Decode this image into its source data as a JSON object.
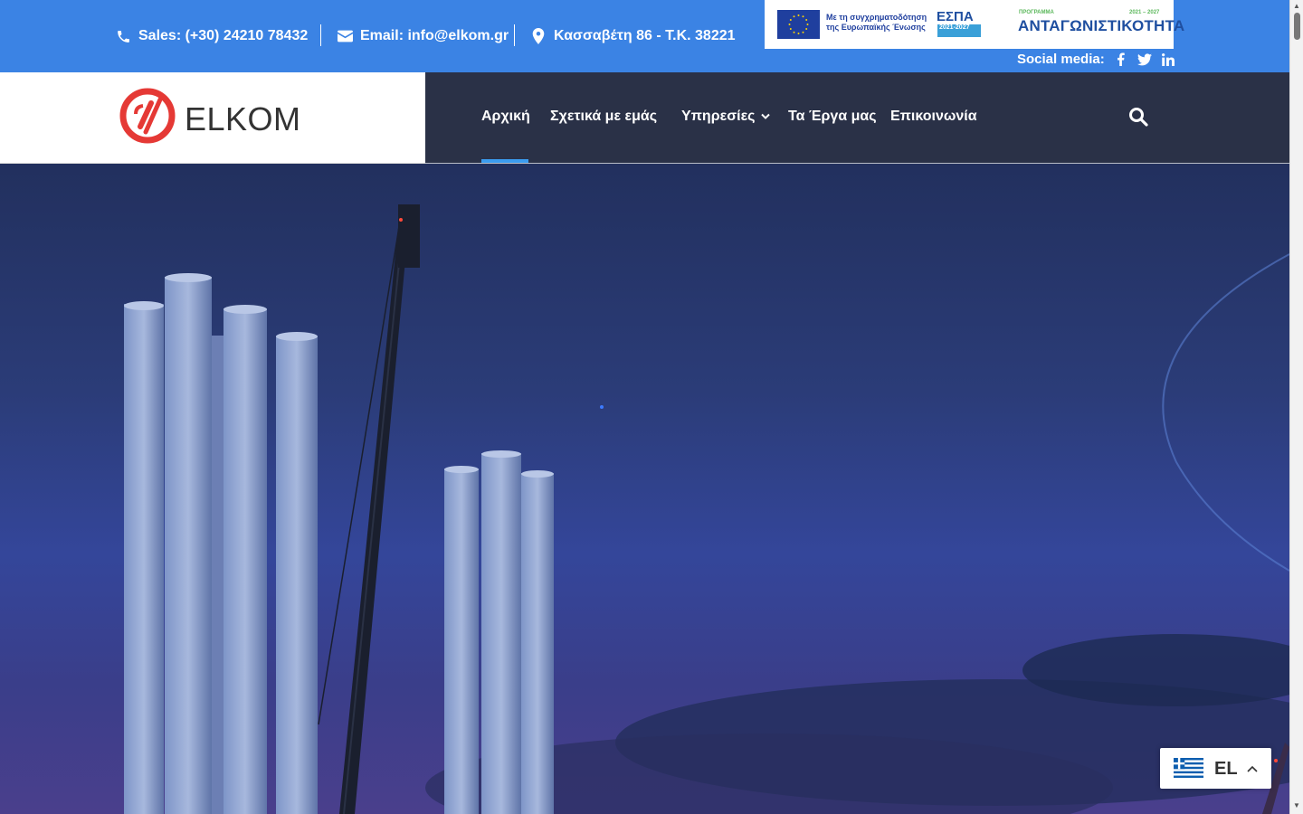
{
  "topbar": {
    "phone": "Sales: (+30) 24210 78432",
    "email": "Email: info@elkom.gr",
    "address": "Κασσαβέτη 86 - Τ.Κ. 38221",
    "social_label": "Social media:",
    "social_icons": [
      "facebook-icon",
      "twitter-icon",
      "linkedin-icon"
    ]
  },
  "espa_banner": {
    "eu_text": "Με τη συγχρηματοδότηση της Ευρωπαϊκής Ένωσης",
    "espa_logo": "ΕΣΠΑ",
    "espa_years": "2021-2027",
    "programme_label": "ΠΡΟΓΡΑΜΜΑ",
    "programme_years": "2021 – 2027",
    "programme_name": "ΑΝΤΑΓΩΝΙΣΤΙΚΟΤΗΤΑ"
  },
  "header": {
    "logo_text": "ELKOM",
    "nav": [
      {
        "label": "Αρχική",
        "active": true
      },
      {
        "label": "Σχετικά με εμάς"
      },
      {
        "label": "Υπηρεσίες",
        "has_dropdown": true
      },
      {
        "label": "Τα Έργα μας"
      },
      {
        "label": "Επικοινωνία"
      }
    ]
  },
  "language": {
    "code": "EL"
  },
  "colors": {
    "topbar": "#3b83e4",
    "navbar": "#2a3147",
    "accent": "#3b9cf0",
    "logo_red": "#e53935"
  }
}
